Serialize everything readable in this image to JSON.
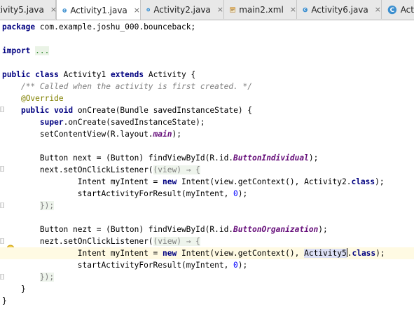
{
  "tabs": [
    {
      "name": "tivity5.java",
      "icon": "java-class-icon",
      "active": false
    },
    {
      "name": "Activity1.java",
      "icon": "java-class-icon",
      "active": true
    },
    {
      "name": "Activity2.java",
      "icon": "java-class-icon",
      "active": false
    },
    {
      "name": "main2.xml",
      "icon": "xml-file-icon",
      "active": false
    },
    {
      "name": "Activity6.java",
      "icon": "java-class-icon",
      "active": false
    },
    {
      "name": "Act",
      "icon": "java-class-icon",
      "active": false
    }
  ],
  "tab_close_glyph": "×",
  "colors": {
    "keyword": "#000080",
    "comment": "#808080",
    "annotation": "#808000",
    "static_field": "#660e7a",
    "number": "#0000ff",
    "current_line": "#fffae3",
    "selection": "#dde0f5"
  },
  "code": {
    "l01": [
      "package",
      " com.example.joshu_000.bounceback;"
    ],
    "l02": [
      "import",
      " ",
      "..."
    ],
    "l03": [
      "public",
      " ",
      "class",
      " Activity1 ",
      "extends",
      " Activity {"
    ],
    "l04": [
      "    ",
      "/** Called when the activity is first created. */"
    ],
    "l05": [
      "    ",
      "@Override"
    ],
    "l06": [
      "    ",
      "public",
      " ",
      "void",
      " onCreate(Bundle savedInstanceState) {"
    ],
    "l07": [
      "        ",
      "super",
      ".onCreate(savedInstanceState);"
    ],
    "l08": [
      "        setContentView(R.layout.",
      "main",
      ");"
    ],
    "l09": [
      "        Button next = (Button) findViewById(R.id.",
      "ButtonIndividual",
      ");"
    ],
    "l10": [
      "        next.setOnClickListener(",
      "(view) → {"
    ],
    "l11": [
      "                Intent myIntent = ",
      "new",
      " Intent(view.getContext(), Activity2.",
      "class",
      ");"
    ],
    "l12": [
      "                startActivityForResult(myIntent, ",
      "0",
      ");"
    ],
    "l13": [
      "        ",
      "});"
    ],
    "l14": [
      "        Button nezt = (Button) findViewById(R.id.",
      "ButtonOrganization",
      ");"
    ],
    "l15": [
      "        nezt.setOnClickListener(",
      "(view) → {"
    ],
    "l16": [
      "                Intent myIntent = ",
      "new",
      " Intent(view.getContext(), ",
      "Activity5",
      ".",
      "class",
      ");"
    ],
    "l17": [
      "                startActivityForResult(myIntent, ",
      "0",
      ");"
    ],
    "l18": [
      "        ",
      "});"
    ],
    "l19": [
      "    }"
    ],
    "l20": [
      "}"
    ]
  }
}
